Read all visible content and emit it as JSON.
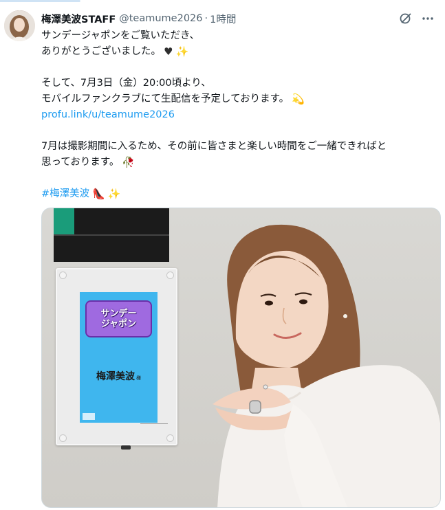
{
  "tweet": {
    "name": "梅澤美波STAFF",
    "handle": "@teamume2026",
    "dot": "·",
    "time": "1時間",
    "lines": [
      "サンデージャポンをご覧いただき、",
      "ありがとうございました。",
      "",
      "そして、7月3日（金）20:00頃より、",
      "モバイルファンクラブにて生配信を予定しております。",
      "profu.link/u/teamume2026",
      "",
      "7月は撮影期間に入るため、その前に皆さまと楽しい時間をご一緒できればと",
      "思っております。",
      "",
      "#梅澤美波"
    ]
  },
  "icons": {
    "grok": "grok-icon",
    "more": "more-icon",
    "heart": "black-heart-emoji",
    "sparkles": "sparkles-emoji",
    "dizzy": "dizzy-star-emoji",
    "rose": "rose-emoji",
    "heel": "high-heel-emoji"
  },
  "media": {
    "logo_line1": "サンデー",
    "logo_line2": "ジャポン",
    "panel_name": "梅澤美波",
    "panel_sama": "様"
  },
  "colors": {
    "link": "#1d9bf0",
    "secondary": "#536471",
    "panel": "#3fb6ee"
  }
}
